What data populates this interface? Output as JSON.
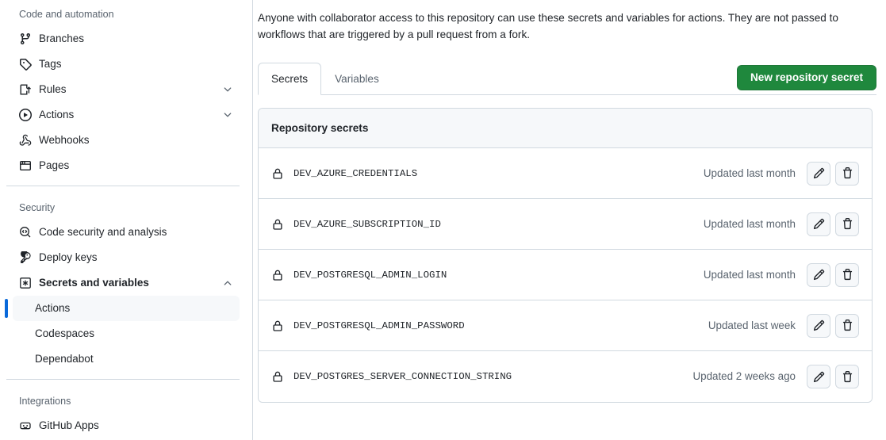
{
  "sidebar": {
    "groups": [
      {
        "title": "Code and automation",
        "items": [
          {
            "label": "Branches",
            "icon": "git-branch-icon",
            "chevron": false
          },
          {
            "label": "Tags",
            "icon": "tag-icon",
            "chevron": false
          },
          {
            "label": "Rules",
            "icon": "rules-icon",
            "chevron": true
          },
          {
            "label": "Actions",
            "icon": "play-circle-icon",
            "chevron": true
          },
          {
            "label": "Webhooks",
            "icon": "webhook-icon",
            "chevron": false
          },
          {
            "label": "Pages",
            "icon": "browser-icon",
            "chevron": false
          }
        ]
      },
      {
        "title": "Security",
        "items": [
          {
            "label": "Code security and analysis",
            "icon": "code-scan-icon",
            "chevron": false
          },
          {
            "label": "Deploy keys",
            "icon": "key-icon",
            "chevron": false
          },
          {
            "label": "Secrets and variables",
            "icon": "asterisk-box-icon",
            "chevron": true,
            "expanded": true
          }
        ],
        "subitems": [
          {
            "label": "Actions",
            "active": true
          },
          {
            "label": "Codespaces",
            "active": false
          },
          {
            "label": "Dependabot",
            "active": false
          }
        ]
      },
      {
        "title": "Integrations",
        "items": [
          {
            "label": "GitHub Apps",
            "icon": "github-apps-icon",
            "chevron": false
          }
        ]
      }
    ]
  },
  "main": {
    "description": "Anyone with collaborator access to this repository can use these secrets and variables for actions. They are not passed to workflows that are triggered by a pull request from a fork.",
    "tabs": [
      {
        "label": "Secrets",
        "active": true
      },
      {
        "label": "Variables",
        "active": false
      }
    ],
    "new_secret_button": "New repository secret",
    "card": {
      "header": "Repository secrets",
      "rows": [
        {
          "name": "DEV_AZURE_CREDENTIALS",
          "updated": "Updated last month",
          "lock_icon": "lock-icon",
          "edit_icon": "pencil-icon",
          "delete_icon": "trash-icon"
        },
        {
          "name": "DEV_AZURE_SUBSCRIPTION_ID",
          "updated": "Updated last month",
          "lock_icon": "lock-icon",
          "edit_icon": "pencil-icon",
          "delete_icon": "trash-icon"
        },
        {
          "name": "DEV_POSTGRESQL_ADMIN_LOGIN",
          "updated": "Updated last month",
          "lock_icon": "lock-icon",
          "edit_icon": "pencil-icon",
          "delete_icon": "trash-icon"
        },
        {
          "name": "DEV_POSTGRESQL_ADMIN_PASSWORD",
          "updated": "Updated last week",
          "lock_icon": "lock-icon",
          "edit_icon": "pencil-icon",
          "delete_icon": "trash-icon"
        },
        {
          "name": "DEV_POSTGRES_SERVER_CONNECTION_STRING",
          "updated": "Updated 2 weeks ago",
          "lock_icon": "lock-icon",
          "edit_icon": "pencil-icon",
          "delete_icon": "trash-icon"
        }
      ]
    }
  },
  "colors": {
    "green_button": "#1f883d",
    "active_indicator": "#0969da",
    "border": "#d1d9e0",
    "muted_text": "#59636e",
    "header_bg": "#f6f8fa"
  }
}
